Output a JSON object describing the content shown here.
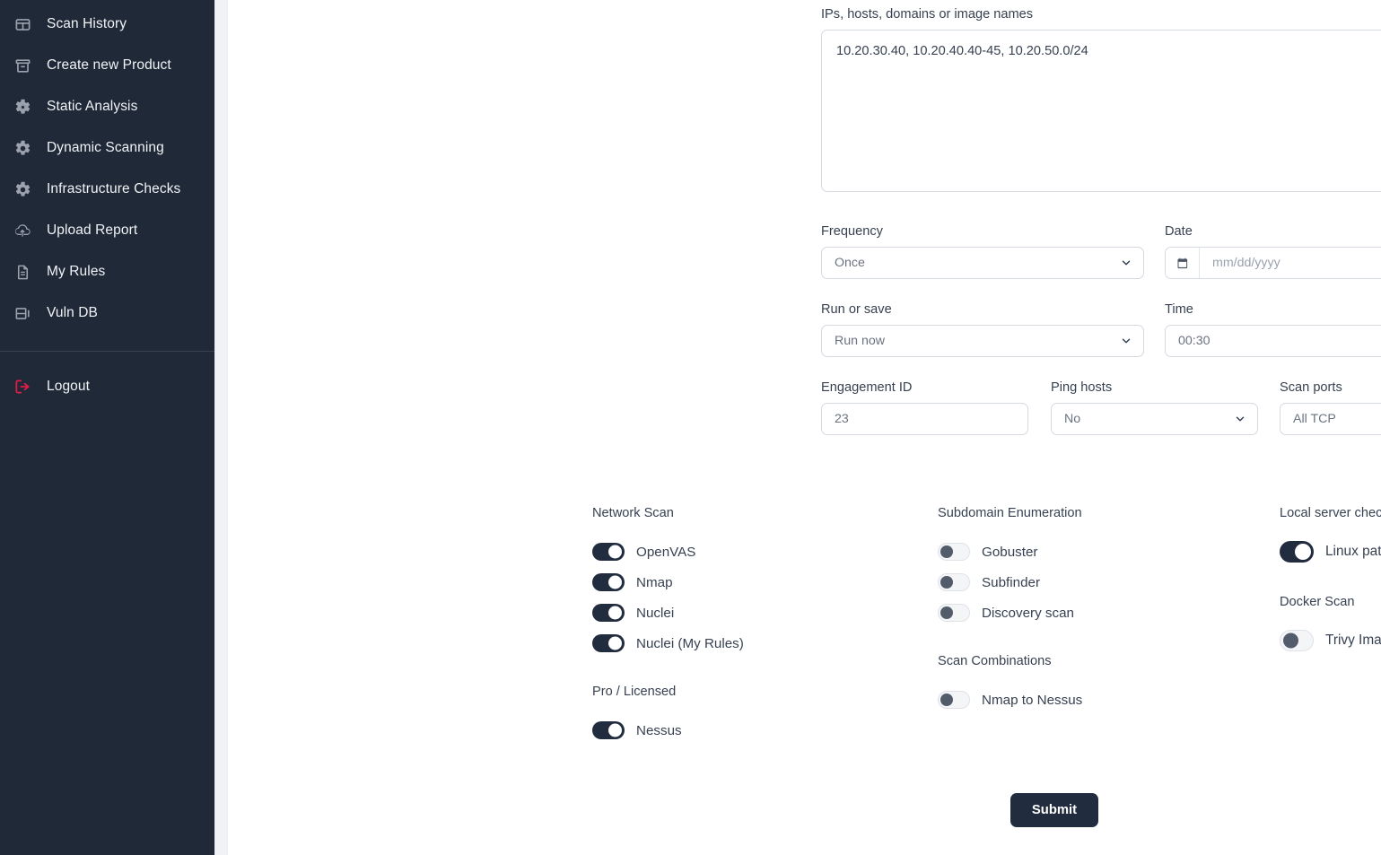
{
  "sidebar": {
    "items": [
      {
        "label": "Scan History",
        "icon": "table-icon"
      },
      {
        "label": "Create new Product",
        "icon": "archive-box-icon"
      },
      {
        "label": "Static Analysis",
        "icon": "gear-icon"
      },
      {
        "label": "Dynamic Scanning",
        "icon": "gear-icon"
      },
      {
        "label": "Infrastructure Checks",
        "icon": "gear-icon"
      },
      {
        "label": "Upload Report",
        "icon": "cloud-upload-icon"
      },
      {
        "label": "My Rules",
        "icon": "document-icon"
      },
      {
        "label": "Vuln DB",
        "icon": "database-icon"
      }
    ],
    "logout": {
      "label": "Logout",
      "icon": "logout-icon",
      "color": "#e11d48"
    },
    "background_color": "#1f2937"
  },
  "form": {
    "targets": {
      "label": "IPs, hosts, domains or image names",
      "value": "10.20.30.40, 10.20.40.40-45, 10.20.50.0/24",
      "placeholder": ""
    },
    "frequency": {
      "label": "Frequency",
      "value": "Once"
    },
    "date": {
      "label": "Date",
      "value": "",
      "placeholder": "mm/dd/yyyy",
      "icon": "calendar-icon"
    },
    "run_or_save": {
      "label": "Run or save",
      "value": "Run now"
    },
    "time": {
      "label": "Time",
      "value": "00:30"
    },
    "engagement_id": {
      "label": "Engagement ID",
      "value": "23",
      "placeholder": ""
    },
    "ping_hosts": {
      "label": "Ping hosts",
      "value": "No"
    },
    "scan_ports": {
      "label": "Scan ports",
      "value": "All TCP"
    }
  },
  "toggle_columns": [
    {
      "groups": [
        {
          "title": "Network Scan",
          "toggles": [
            {
              "label": "OpenVAS",
              "on": true
            },
            {
              "label": "Nmap",
              "on": true
            },
            {
              "label": "Nuclei",
              "on": true
            },
            {
              "label": "Nuclei (My Rules)",
              "on": true
            }
          ]
        },
        {
          "title": "Pro / Licensed",
          "toggles": [
            {
              "label": "Nessus",
              "on": true
            }
          ]
        }
      ]
    },
    {
      "groups": [
        {
          "title": "Subdomain Enumeration",
          "toggles": [
            {
              "label": "Gobuster",
              "on": false
            },
            {
              "label": "Subfinder",
              "on": false
            },
            {
              "label": "Discovery scan",
              "on": false
            }
          ]
        },
        {
          "title": "Scan Combinations",
          "toggles": [
            {
              "label": "Nmap to Nessus",
              "on": false
            }
          ]
        }
      ]
    },
    {
      "groups": [
        {
          "title": "Local server checks:",
          "toggles": [
            {
              "label": "Linux patching",
              "on": true
            }
          ]
        },
        {
          "title": "Docker Scan",
          "toggles": [
            {
              "label": "Trivy Image (name:tag)",
              "on": false
            }
          ]
        }
      ]
    }
  ],
  "submit": {
    "label": "Submit",
    "color": "#222c3f"
  }
}
